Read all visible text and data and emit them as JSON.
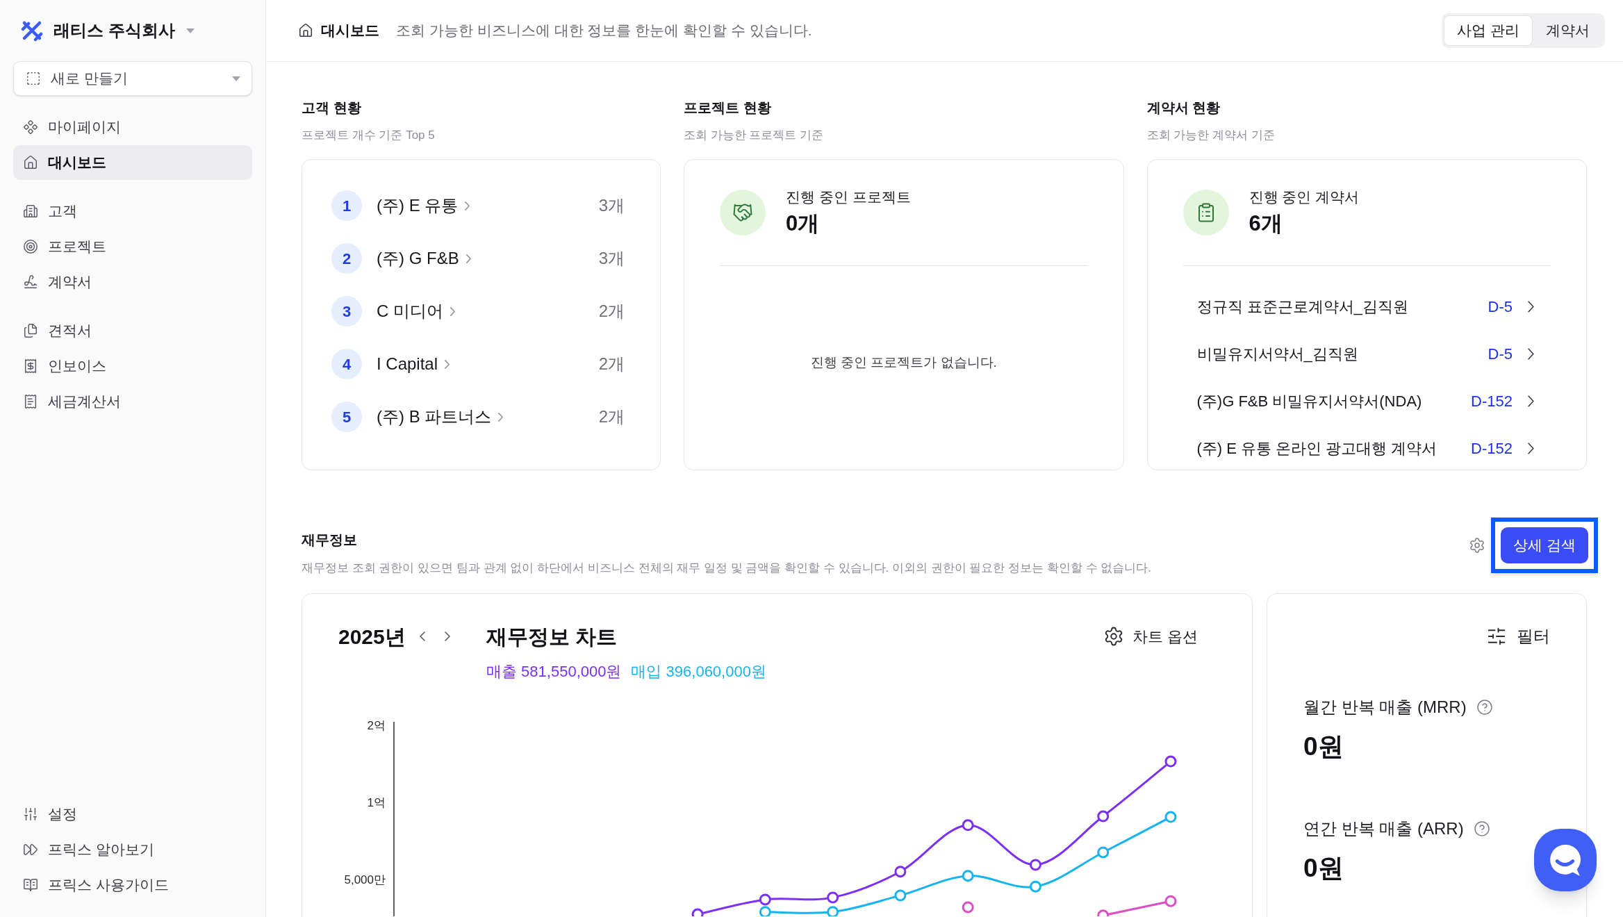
{
  "sidebar": {
    "company": "래티스 주식회사",
    "new_button": "새로 만들기",
    "nav_groups": [
      {
        "items": [
          {
            "label": "마이페이지",
            "selected": false
          },
          {
            "label": "대시보드",
            "selected": true
          }
        ]
      },
      {
        "items": [
          {
            "label": "고객",
            "selected": false
          },
          {
            "label": "프로젝트",
            "selected": false
          },
          {
            "label": "계약서",
            "selected": false
          }
        ]
      },
      {
        "items": [
          {
            "label": "견적서",
            "selected": false
          },
          {
            "label": "인보이스",
            "selected": false
          },
          {
            "label": "세금계산서",
            "selected": false
          }
        ]
      }
    ],
    "footer_items": [
      {
        "label": "설정",
        "selected": false
      },
      {
        "label": "프릭스 알아보기",
        "selected": false
      },
      {
        "label": "프릭스 사용가이드",
        "selected": false
      }
    ]
  },
  "header": {
    "title": "대시보드",
    "description": "조회 가능한 비즈니스에 대한 정보를 한눈에 확인할 수 있습니다.",
    "tabs": [
      {
        "label": "사업 관리",
        "selected": true
      },
      {
        "label": "계약서",
        "selected": false
      }
    ]
  },
  "customers": {
    "title": "고객 현황",
    "subtitle": "프로젝트 개수 기준 Top 5",
    "rows": [
      {
        "rank": "1",
        "name": "(주) E 유통",
        "count": "3개"
      },
      {
        "rank": "2",
        "name": "(주) G F&B",
        "count": "3개"
      },
      {
        "rank": "3",
        "name": "C 미디어",
        "count": "2개"
      },
      {
        "rank": "4",
        "name": "I Capital",
        "count": "2개"
      },
      {
        "rank": "5",
        "name": "(주) B 파트너스",
        "count": "2개"
      }
    ]
  },
  "projects": {
    "title": "프로젝트 현황",
    "subtitle": "조회 가능한 프로젝트 기준",
    "stat_label": "진행 중인 프로젝트",
    "stat_value": "0개",
    "empty_message": "진행 중인 프로젝트가 없습니다."
  },
  "contracts": {
    "title": "계약서 현황",
    "subtitle": "조회 가능한 계약서 기준",
    "stat_label": "진행 중인 계약서",
    "stat_value": "6개",
    "rows": [
      {
        "name": "정규직 표준근로계약서_김직원",
        "due": "D-5"
      },
      {
        "name": "비밀유지서약서_김직원",
        "due": "D-5"
      },
      {
        "name": "(주)G F&B 비밀유지서약서(NDA)",
        "due": "D-152"
      },
      {
        "name": "(주) E 유통 온라인 광고대행 계약서",
        "due": "D-152"
      }
    ]
  },
  "finance": {
    "title": "재무정보",
    "description": "재무정보 조회 권한이 있으면 팀과 관계 없이 하단에서 비즈니스 전체의 재무 일정 및 금액을 확인할 수 있습니다. 이외의 권한이 필요한 정보는 확인할 수 없습니다.",
    "search_button": "상세 검색",
    "chart_panel": {
      "year": "2025년",
      "title": "재무정보 차트",
      "options_button": "차트 옵션",
      "legend": [
        {
          "label": "매출 581,550,000원",
          "color": "#7b2ff7"
        },
        {
          "label": "매입 396,060,000원",
          "color": "#14b4f0"
        }
      ],
      "axis_labels": [
        "2억",
        "1억",
        "5,000만"
      ]
    },
    "metrics_panel": {
      "filter_button": "필터",
      "metrics": [
        {
          "label": "월간 반복 매출 (MRR)",
          "value": "0원"
        },
        {
          "label": "연간 반복 매출 (ARR)",
          "value": "0원"
        }
      ]
    }
  }
}
